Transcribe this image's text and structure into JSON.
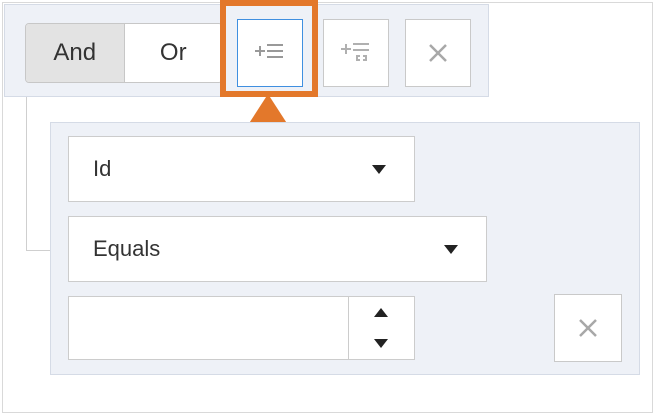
{
  "toolbar": {
    "and_label": "And",
    "or_label": "Or",
    "add_condition_icon": "add-condition-icon",
    "add_group_icon": "add-group-icon",
    "remove_icon": "close-icon"
  },
  "rule": {
    "field_value": "Id",
    "operator_value": "Equals",
    "value_input": "",
    "remove_icon": "close-icon"
  },
  "annotation": {
    "highlight_color": "#e3782b"
  },
  "colors": {
    "panel_bg": "#eef1f7",
    "selected_border": "#3f8fe0"
  }
}
